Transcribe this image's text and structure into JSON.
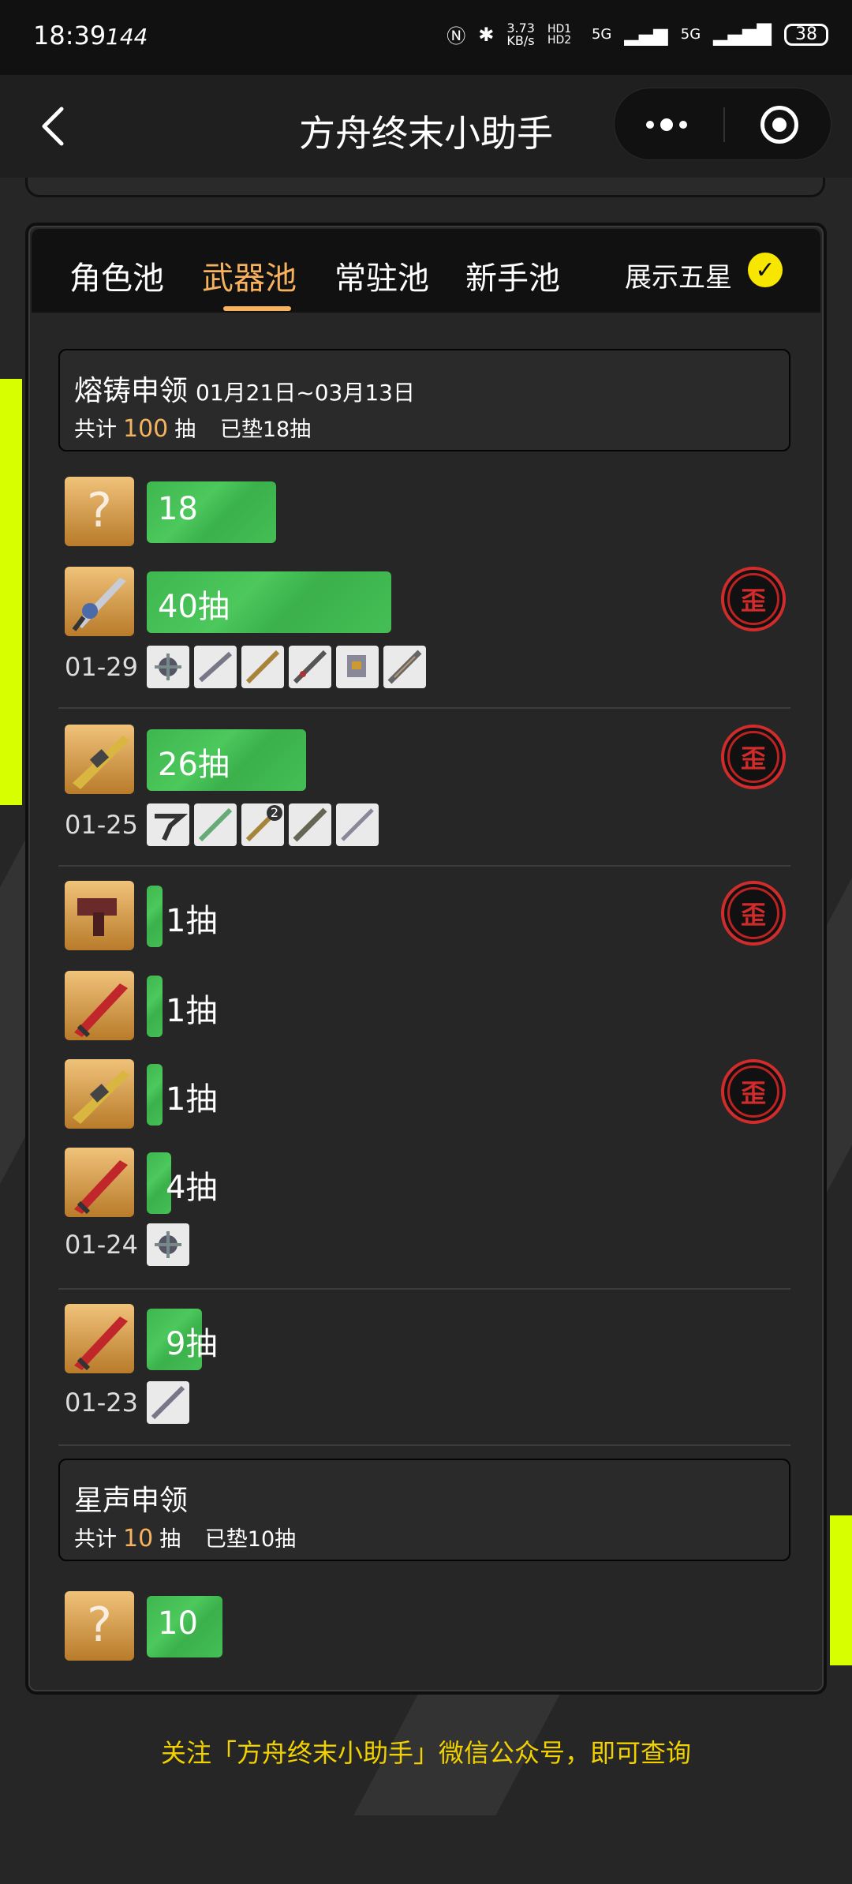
{
  "status_bar": {
    "time": "18:39",
    "refresh_rate": "144",
    "net_speed": "3.73",
    "net_unit": "KB/s",
    "hd": "HD1 HD2",
    "sig1": "5G",
    "sig2": "5G",
    "battery": "38"
  },
  "nav": {
    "title": "方舟终末小助手"
  },
  "tabs": [
    {
      "label": "角色池",
      "active": false
    },
    {
      "label": "武器池",
      "active": true
    },
    {
      "label": "常驻池",
      "active": false
    },
    {
      "label": "新手池",
      "active": false
    }
  ],
  "show_five_star": {
    "label": "展示五星",
    "checked": true,
    "check_mark": "✓"
  },
  "pools": [
    {
      "name": "熔铸申领",
      "date_range": "01月21日~03月13日",
      "total_prefix": "共计",
      "total": "100",
      "total_suffix": "抽",
      "pity": "已垫18抽",
      "current_pity_label": "18"
    },
    {
      "name": "星声申领",
      "total_prefix": "共计",
      "total": "10",
      "total_suffix": "抽",
      "pity": "已垫10抽",
      "current_pity_label": "10"
    }
  ],
  "pulls": [
    {
      "label": "40抽",
      "value": 40,
      "wai": "歪",
      "weapon": "blue-blade"
    },
    {
      "label": "26抽",
      "value": 26,
      "wai": "歪",
      "weapon": "gold-gun"
    },
    {
      "label": "1抽",
      "value": 1,
      "wai": "歪",
      "weapon": "red-gun"
    },
    {
      "label": "1抽",
      "value": 1,
      "wai": "",
      "weapon": "red-sword"
    },
    {
      "label": "1抽",
      "value": 1,
      "wai": "歪",
      "weapon": "gold-gun"
    },
    {
      "label": "4抽",
      "value": 4,
      "wai": "",
      "weapon": "red-sword"
    },
    {
      "label": "9抽",
      "value": 9,
      "wai": "",
      "weapon": "red-sword"
    }
  ],
  "date_groups": [
    {
      "date": "01-29",
      "minis": [
        "",
        "",
        "",
        "",
        "",
        ""
      ]
    },
    {
      "date": "01-25",
      "minis": [
        "",
        "",
        "2",
        "",
        ""
      ]
    },
    {
      "date": "01-24",
      "minis": [
        ""
      ]
    },
    {
      "date": "01-23",
      "minis": [
        ""
      ]
    }
  ],
  "footer": "关注「方舟终末小助手」微信公众号，即可查询",
  "colors": {
    "accent": "#f6b25e",
    "bar": "#45bf55",
    "wai": "#d12c2c",
    "footer": "#f1d100"
  }
}
